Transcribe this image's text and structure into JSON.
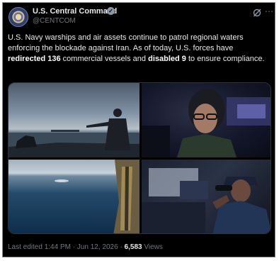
{
  "account": {
    "name": "U.S. Central Command",
    "handle": "@CENTCOM",
    "verified_glyph": "✓"
  },
  "post": {
    "text_1": "U.S. Navy warships and air assets continue to patrol regional waters enforcing the blockade against Iran. As of today, U.S. forces have ",
    "bold_1": "redirected 136",
    "text_2": " commercial vessels and ",
    "bold_2": "disabled 9",
    "text_3": " to ensure compliance."
  },
  "footer": {
    "edited": "Last edited 1:44 PM · Jun 12, 2026 · ",
    "views_count": "6,583",
    "views_label": " Views"
  },
  "icons": {
    "grok": "grok-icon",
    "more": "more-icon",
    "verified": "verified-badge-icon"
  },
  "colors": {
    "background": "#000000",
    "text": "#e7e9ea",
    "secondary_text": "#71767b"
  }
}
